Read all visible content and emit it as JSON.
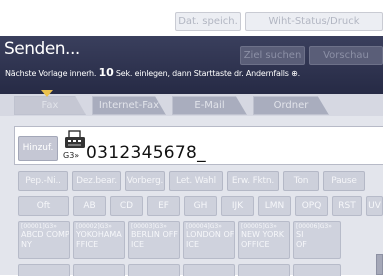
{
  "top_buttons": [
    {
      "label": "Dat. speich."
    },
    {
      "label": "Wiht-Status/Druck"
    }
  ],
  "header": {
    "title": "Senden...",
    "hint_before": "Nächste Vorlage innerh.",
    "hint_seconds": "10",
    "hint_after": "Sek. einlegen, dann Starttaste dr. Andernfalls ⊕."
  },
  "header_buttons": {
    "dest_search": "Ziel suchen",
    "preview": "Vorschau"
  },
  "tabs": [
    {
      "label": "Fax",
      "selected": true
    },
    {
      "label": "Internet-Fax"
    },
    {
      "label": "E-Mail"
    },
    {
      "label": "Ordner"
    }
  ],
  "entry": {
    "add_label": "Hinzuf.",
    "line_label": "G3»",
    "number": "0312345678_"
  },
  "function_buttons": [
    {
      "label": "Pep.-Ni.."
    },
    {
      "label": "Dez.bear."
    },
    {
      "label": "Vorberg."
    },
    {
      "label": "Let. Wahl"
    },
    {
      "label": "Erw. Fktn."
    },
    {
      "label": "Ton"
    },
    {
      "label": "Pause"
    }
  ],
  "index_buttons": [
    {
      "label": "Oft"
    },
    {
      "label": "AB"
    },
    {
      "label": "CD"
    },
    {
      "label": "EF"
    },
    {
      "label": "GH"
    },
    {
      "label": "IJK"
    },
    {
      "label": "LMN"
    },
    {
      "label": "OPQ"
    },
    {
      "label": "RST"
    },
    {
      "label": "UV"
    }
  ],
  "destinations": [
    {
      "tag": "[00001]G3»",
      "line1": "ABCD COMPA",
      "line2": "NY"
    },
    {
      "tag": "[00002]G3»",
      "line1": "YOKOHAMA O",
      "line2": "FFICE"
    },
    {
      "tag": "[00003]G3»",
      "line1": "BERLIN OFF",
      "line2": "ICE"
    },
    {
      "tag": "[00004]G3»",
      "line1": "LONDON OFF",
      "line2": "ICE"
    },
    {
      "tag": "[00005]G3»",
      "line1": "NEW YORK",
      "line2": "OFFICE"
    },
    {
      "tag": "[00006]G3»",
      "line1": "SI",
      "line2": "OF"
    }
  ],
  "colors": {
    "header_band": "#2c3150",
    "tab_marker": "#ebc24f",
    "workspace": "#e3e5ec"
  }
}
